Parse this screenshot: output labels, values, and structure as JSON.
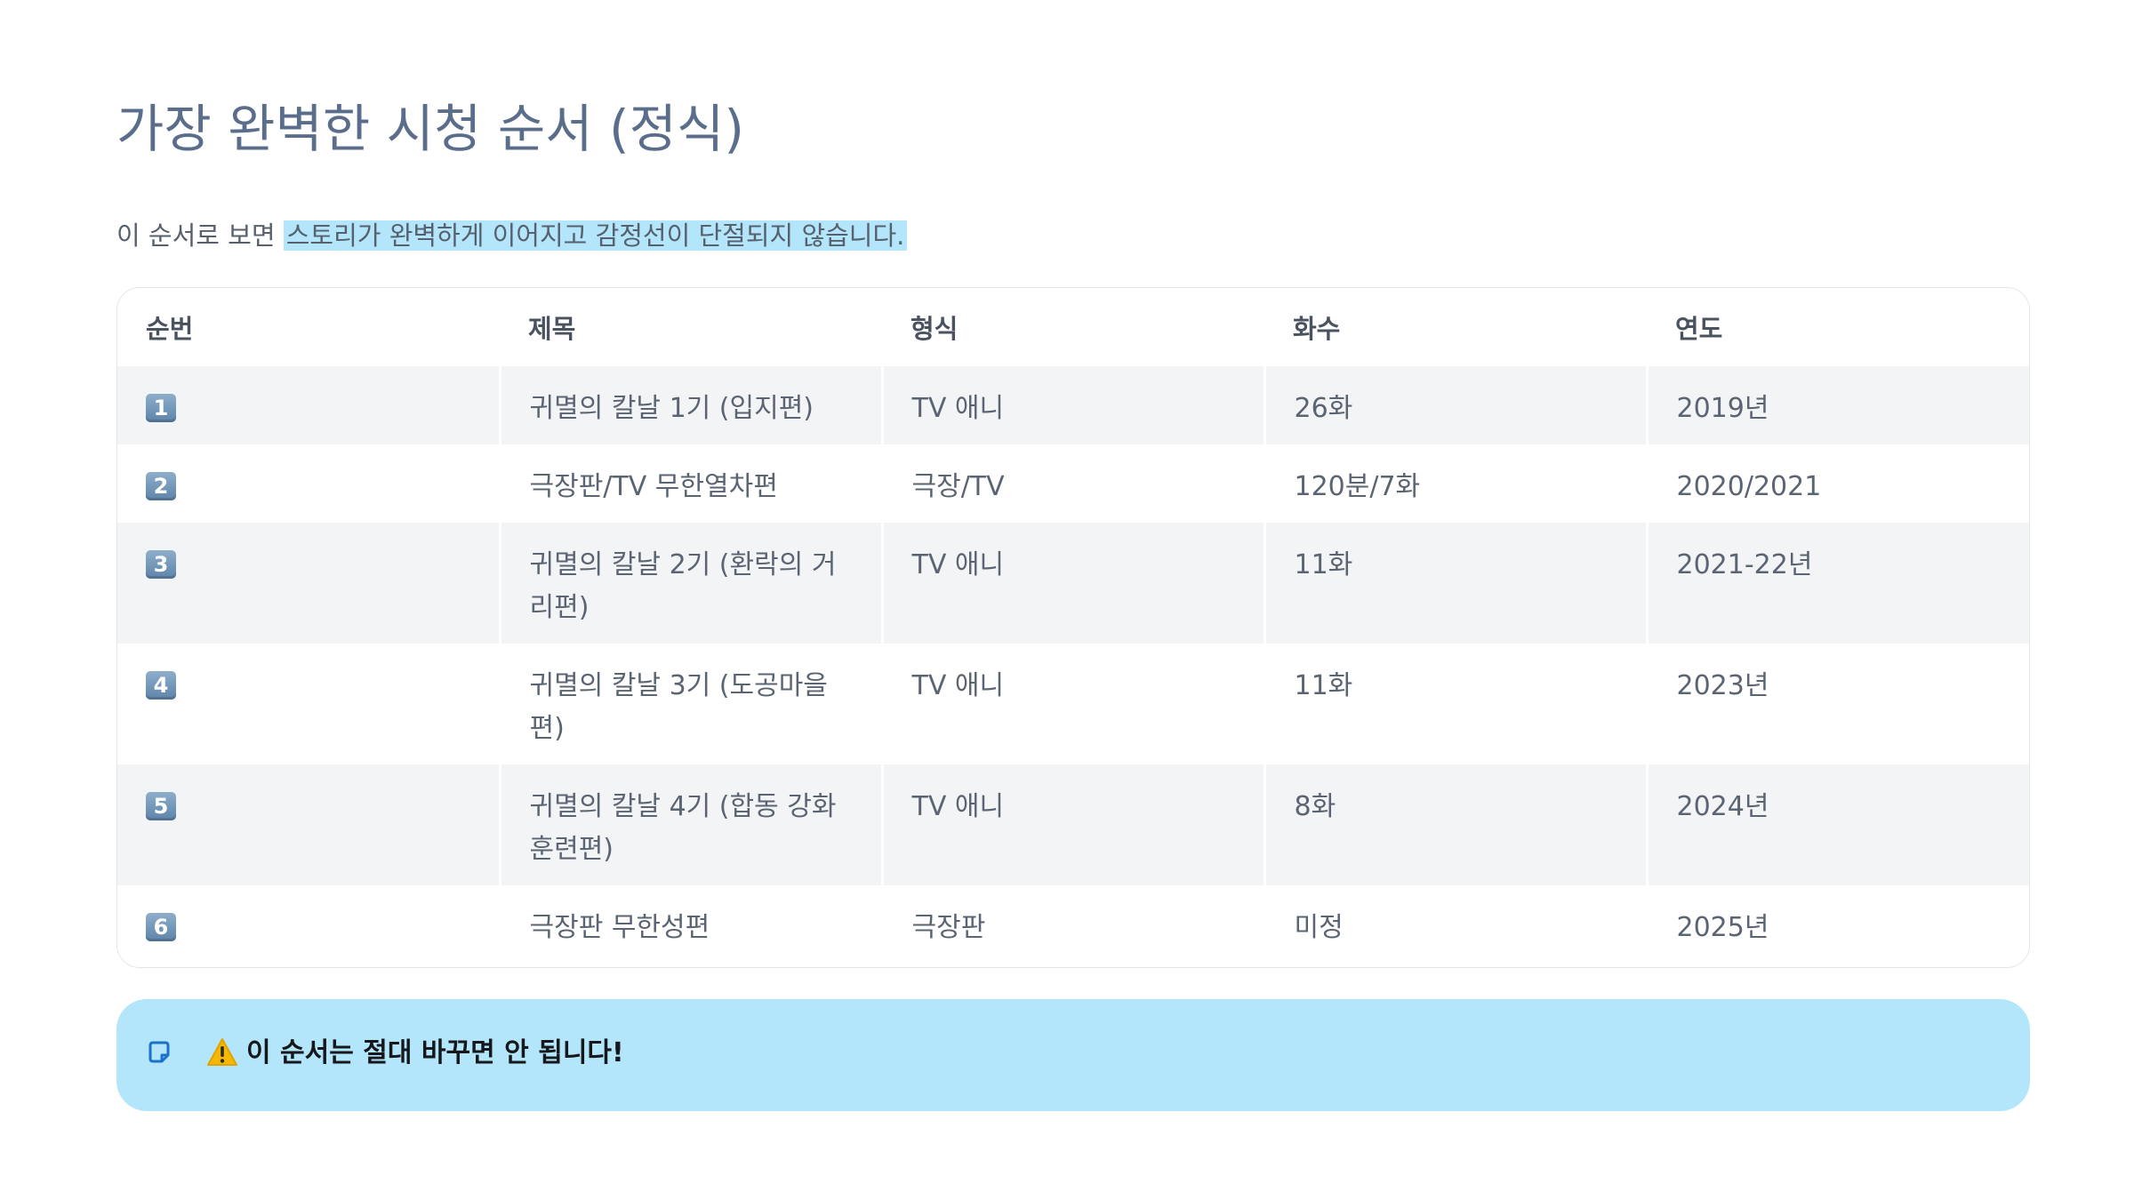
{
  "page": {
    "title": "가장 완벽한 시청 순서 (정식)",
    "subtitle_plain": "이 순서로 보면 ",
    "subtitle_highlight": "스토리가 완벽하게 이어지고 감정선이 단절되지 않습니다."
  },
  "table": {
    "headers": [
      "순번",
      "제목",
      "형식",
      "화수",
      "연도"
    ],
    "rows": [
      {
        "num": "1",
        "title": "귀멸의 칼날 1기 (입지편)",
        "format": "TV 애니",
        "episodes": "26화",
        "year": "2019년"
      },
      {
        "num": "2",
        "title": "극장판/TV 무한열차편",
        "format": "극장/TV",
        "episodes": "120분/7화",
        "year": "2020/2021"
      },
      {
        "num": "3",
        "title": "귀멸의 칼날 2기 (환락의 거리편)",
        "format": "TV 애니",
        "episodes": "11화",
        "year": "2021-22년"
      },
      {
        "num": "4",
        "title": "귀멸의 칼날 3기 (도공마을편)",
        "format": "TV 애니",
        "episodes": "11화",
        "year": "2023년"
      },
      {
        "num": "5",
        "title": "귀멸의 칼날 4기 (합동 강화 훈련편)",
        "format": "TV 애니",
        "episodes": "8화",
        "year": "2024년"
      },
      {
        "num": "6",
        "title": "극장판 무한성편",
        "format": "극장판",
        "episodes": "미정",
        "year": "2025년"
      }
    ]
  },
  "callout": {
    "note_icon": "note-icon",
    "warning_icon": "warning-icon",
    "text": "이 순서는 절대 바꾸면 안 됩니다!"
  },
  "colors": {
    "title": "#5a6e8c",
    "highlight": "#b3e5fb",
    "row_alt": "#f3f4f5",
    "callout_bg": "#b3e5fb",
    "keycap": "#6f93b6"
  }
}
